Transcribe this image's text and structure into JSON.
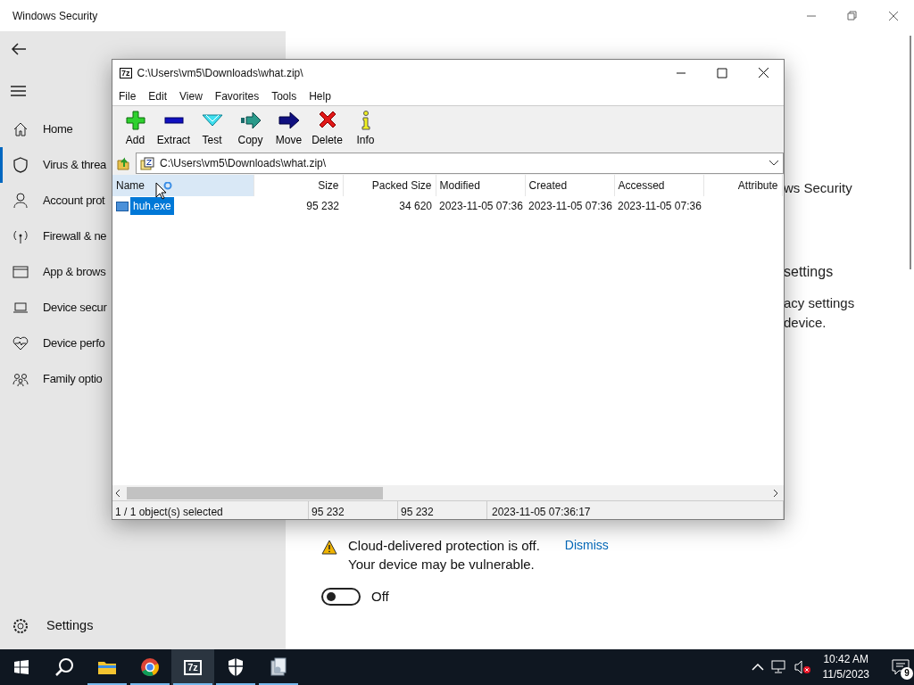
{
  "security_app": {
    "title": "Windows Security",
    "nav": [
      {
        "kind": "home",
        "label": "Home",
        "selected": false
      },
      {
        "kind": "shield",
        "label": "Virus & threa",
        "selected": true
      },
      {
        "kind": "person",
        "label": "Account prot",
        "selected": false
      },
      {
        "kind": "antenna",
        "label": "Firewall & ne",
        "selected": false
      },
      {
        "kind": "browser",
        "label": "App & brows",
        "selected": false
      },
      {
        "kind": "laptop",
        "label": "Device secur",
        "selected": false
      },
      {
        "kind": "heart",
        "label": "Device perfo",
        "selected": false
      },
      {
        "kind": "family",
        "label": "Family optio",
        "selected": false
      }
    ],
    "settings": "Settings",
    "main_fragments": [
      {
        "kind": "text",
        "text": "ws Security"
      },
      {
        "kind": "heading",
        "text": "settings"
      },
      {
        "kind": "text",
        "text": "acy settings"
      },
      {
        "kind": "text",
        "text": "device."
      }
    ],
    "warning": {
      "message": "Cloud-delivered protection is off.",
      "detail": "Your device may be vulnerable.",
      "action": "Dismiss"
    },
    "toggle": {
      "on": false,
      "label": "Off"
    }
  },
  "archive_window": {
    "icon_text": "7z",
    "title": "C:\\Users\\vm5\\Downloads\\what.zip\\",
    "menu": [
      "File",
      "Edit",
      "View",
      "Favorites",
      "Tools",
      "Help"
    ],
    "toolbar": [
      {
        "kind": "add",
        "label": "Add"
      },
      {
        "kind": "extract",
        "label": "Extract"
      },
      {
        "kind": "test",
        "label": "Test"
      },
      {
        "kind": "copy",
        "label": "Copy"
      },
      {
        "kind": "move",
        "label": "Move"
      },
      {
        "kind": "delete",
        "label": "Delete"
      },
      {
        "kind": "info",
        "label": "Info"
      }
    ],
    "address": "C:\\Users\\vm5\\Downloads\\what.zip\\",
    "columns": [
      {
        "label": "Name",
        "selected": true
      },
      {
        "label": "Size",
        "selected": false
      },
      {
        "label": "Packed Size",
        "selected": false
      },
      {
        "label": "Modified",
        "selected": false
      },
      {
        "label": "Created",
        "selected": false
      },
      {
        "label": "Accessed",
        "selected": false
      },
      {
        "label": "Attribute",
        "selected": false
      }
    ],
    "rows": [
      {
        "selected": true,
        "cells": [
          "huh.exe",
          "95 232",
          "34 620",
          "2023-11-05 07:36",
          "2023-11-05 07:36",
          "2023-11-05 07:36"
        ]
      }
    ],
    "status": [
      "1 / 1 object(s) selected",
      "95 232",
      "95 232",
      "2023-11-05 07:36:17"
    ]
  },
  "taskbar": {
    "apps": [
      {
        "kind": "files",
        "running": true,
        "selected": false
      },
      {
        "kind": "browser",
        "running": true,
        "selected": false
      },
      {
        "kind": "archiver",
        "label": "7z",
        "running": true,
        "selected": true
      },
      {
        "kind": "shield",
        "running": true,
        "selected": false
      },
      {
        "kind": "installer",
        "running": true,
        "selected": false
      }
    ],
    "time": "10:42 AM",
    "date": "11/5/2023",
    "notifications": "9"
  }
}
